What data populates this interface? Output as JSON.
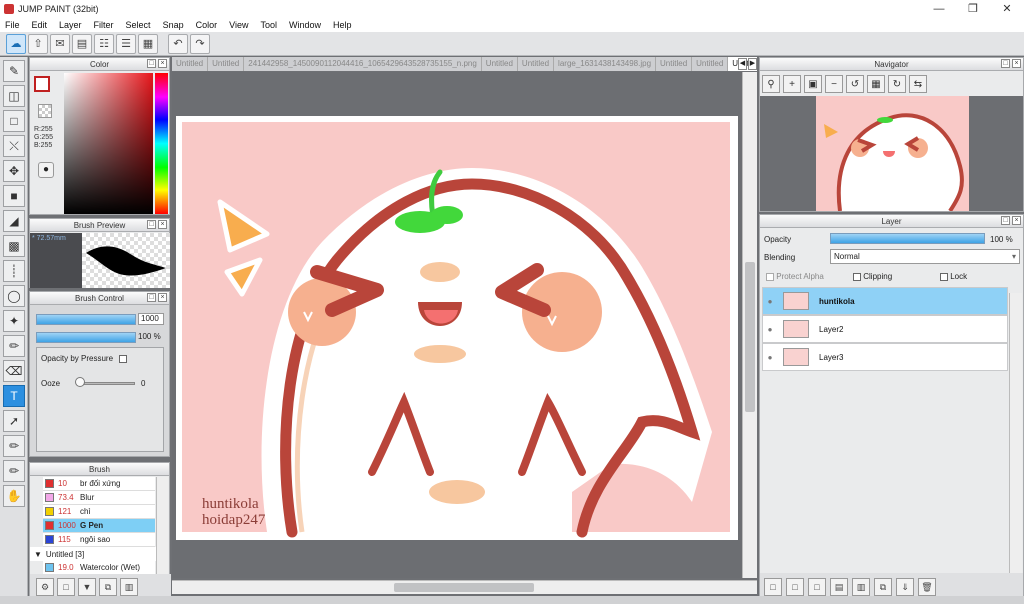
{
  "titlebar": {
    "title": "JUMP PAINT (32bit)",
    "minimize_icon": "minimize-icon",
    "maximize_icon": "restore-icon",
    "close_icon": "close-icon"
  },
  "menu": [
    "File",
    "Edit",
    "Layer",
    "Filter",
    "Select",
    "Snap",
    "Color",
    "View",
    "Tool",
    "Window",
    "Help"
  ],
  "color_panel": {
    "title": "Color",
    "rgb": "R:255\nG:255\nB:255",
    "foreground": "#ffffff",
    "background_pattern": "checker"
  },
  "brush_preview": {
    "title": "Brush Preview",
    "size": "* 72.57mm"
  },
  "brush_control": {
    "title": "Brush Control",
    "size_value": "1000",
    "opacity_value": "100 %",
    "opacity_by_pressure": "Opacity by Pressure",
    "ooze_label": "Ooze",
    "ooze_value": "0"
  },
  "brush_list": {
    "title": "Brush",
    "items": [
      {
        "num": "10",
        "name": "br đối xứng",
        "color": "#e03030"
      },
      {
        "num": "73.4",
        "name": "Blur",
        "color": "#f2a8e8"
      },
      {
        "num": "121",
        "name": "chì",
        "color": "#f2d000"
      },
      {
        "num": "1000",
        "name": "G Pen",
        "color": "#e03030",
        "selected": true
      },
      {
        "num": "115",
        "name": "ngôi sao",
        "color": "#2b45d6"
      }
    ],
    "group": "Untitled [3]",
    "last_item": {
      "num": "19.0",
      "name": "Watercolor (Wet)",
      "color": "#6ec4f0"
    }
  },
  "tabs": [
    {
      "label": "Untitled"
    },
    {
      "label": "Untitled"
    },
    {
      "label": "241442958_1450090112044416_1065429643528735155_n.png"
    },
    {
      "label": "Untitled"
    },
    {
      "label": "Untitled"
    },
    {
      "label": "large_1631438143498.jpg"
    },
    {
      "label": "Untitled"
    },
    {
      "label": "Untitled"
    },
    {
      "label": "Untitled",
      "active": true
    }
  ],
  "artwork": {
    "signature_line1": "huntikola",
    "signature_line2": "hoidap247"
  },
  "navigator": {
    "title": "Navigator"
  },
  "layer_panel": {
    "title": "Layer",
    "opacity_label": "Opacity",
    "opacity_value": "100 %",
    "blending_label": "Blending",
    "blending_value": "Normal",
    "protect_alpha": "Protect Alpha",
    "clipping": "Clipping",
    "lock": "Lock",
    "layers": [
      {
        "name": "huntikola",
        "selected": true
      },
      {
        "name": "Layer2"
      },
      {
        "name": "Layer3"
      }
    ]
  },
  "colors": {
    "accent": "#2c8fe0",
    "selection": "#8fd1f6",
    "canvas_bg": "#f9c9c7",
    "outline": "#b9453a"
  }
}
